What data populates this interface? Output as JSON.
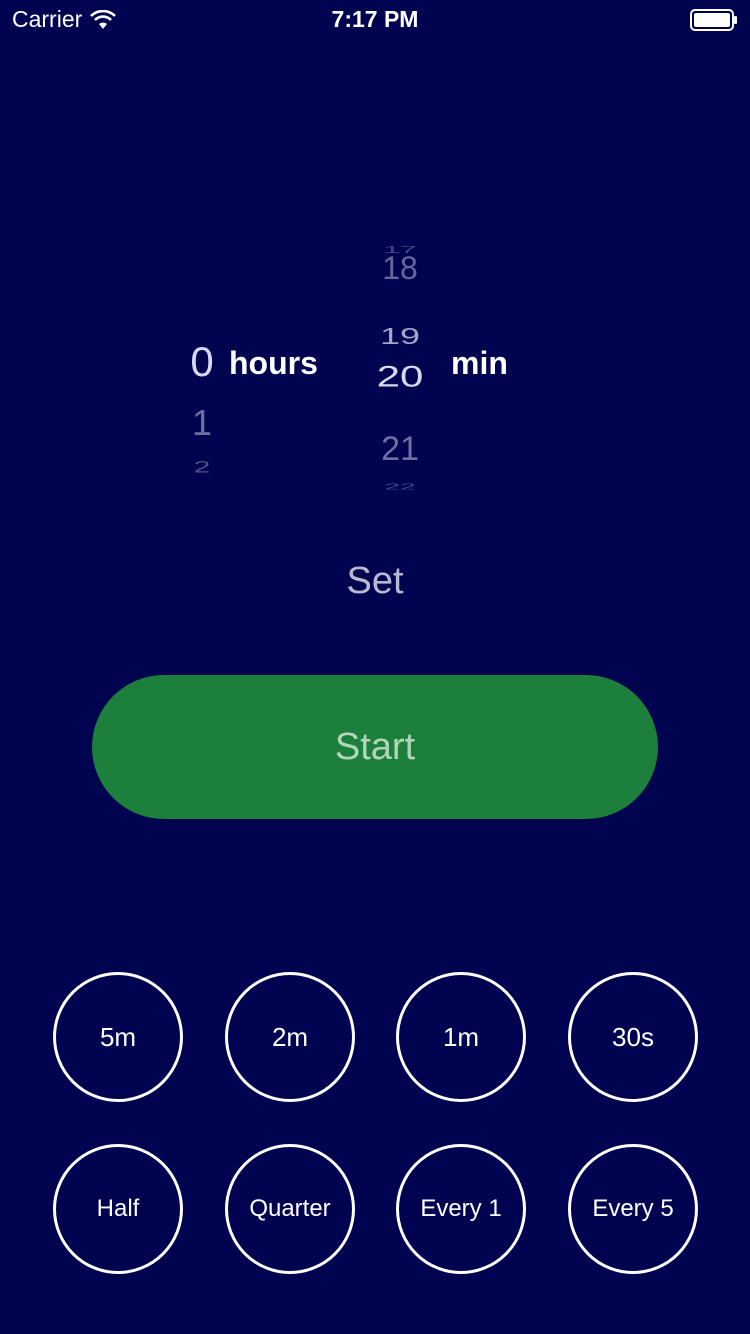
{
  "status_bar": {
    "carrier": "Carrier",
    "time": "7:17 PM"
  },
  "picker": {
    "hours": {
      "selected": "0",
      "below": [
        "1",
        "2"
      ],
      "label": "hours"
    },
    "minutes": {
      "above": [
        "17",
        "18",
        "19"
      ],
      "selected": "20",
      "below": [
        "21",
        "22"
      ],
      "label": "min"
    }
  },
  "set_label": "Set",
  "start_label": "Start",
  "presets_row1": [
    "5m",
    "2m",
    "1m",
    "30s"
  ],
  "presets_row2": [
    "Half",
    "Quarter",
    "Every 1",
    "Every 5"
  ],
  "colors": {
    "background": "#00034f",
    "start_button": "#1c7f3b"
  }
}
